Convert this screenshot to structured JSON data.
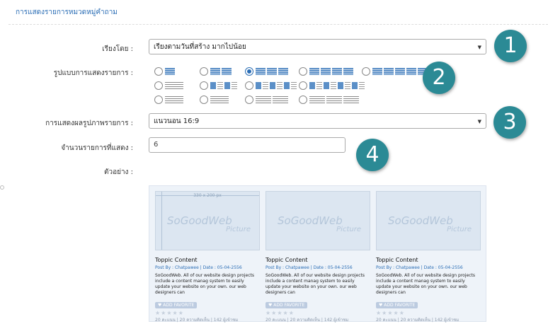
{
  "header": {
    "title": "การแสดงรายการหมวดหมู่คำถาม"
  },
  "form": {
    "sort_label": "เรียงโดย :",
    "sort_value": "เรียงตามวันที่สร้าง มากไปน้อย",
    "layout_label": "รูปแบบการแสดงรายการ :",
    "image_label": "การแสดงผลรูปภาพรายการ :",
    "image_value": "แนวนอน 16:9",
    "count_label": "จำนวนรายการที่แสดง :",
    "count_value": "6",
    "example_label": "ตัวอย่าง :"
  },
  "badges": [
    "1",
    "2",
    "3",
    "4"
  ],
  "layout_options": {
    "selected_index": 2,
    "count": 12
  },
  "preview": {
    "image_size": "330 x 200 px",
    "watermark": "SoGoodWeb",
    "watermark_sub": "Picture",
    "cards": [
      {
        "title": "Toppic Content",
        "meta": "Post By : Chatpawee  |  Date : 05-04-2556",
        "desc": "SoGoodWeb. All of our website design projects include a content manag system to easily update your website on your own. our web designers can",
        "fav": "ADD FAVORITE",
        "stars": "★★★★★",
        "stats": "20 คะแนน | 20 ความคิดเห็น | 142 ผู้เข้าชม"
      },
      {
        "title": "Toppic Content",
        "meta": "Post By : Chatpawee  |  Date : 05-04-2556",
        "desc": "SoGoodWeb. All of our website design projects include a content manag system to easily update your website on your own. our web designers can",
        "fav": "ADD FAVORITE",
        "stars": "★★★★★",
        "stats": "20 คะแนน | 20 ความคิดเห็น | 142 ผู้เข้าชม"
      },
      {
        "title": "Toppic Content",
        "meta": "Post By : Chatpawee  |  Date : 05-04-2556",
        "desc": "SoGoodWeb. All of our website design projects include a content manag system to easily update your website on your own. our web designers can",
        "fav": "ADD FAVORITE",
        "stars": "★★★★★",
        "stats": "20 คะแนน | 20 ความคิดเห็น | 142 ผู้เข้าชม"
      }
    ]
  }
}
